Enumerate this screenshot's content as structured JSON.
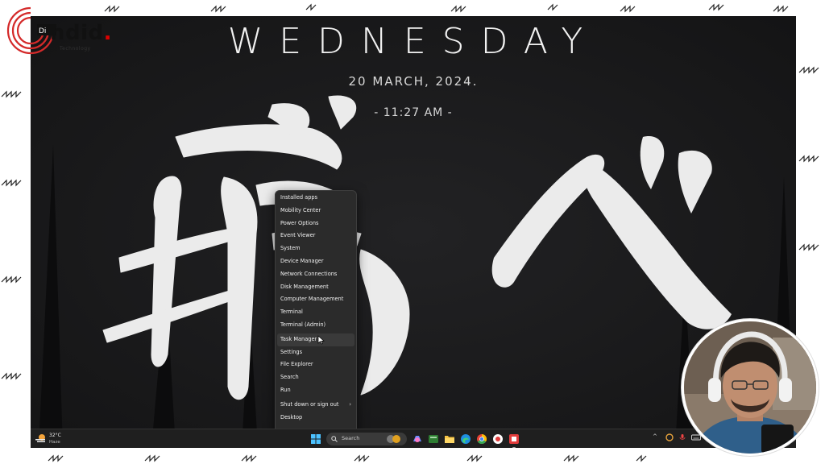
{
  "overlay": {
    "logo_text": "ndid",
    "logo_prefix": "Di",
    "logo_sub": "Technology"
  },
  "desktop": {
    "day": "WEDNESDAY",
    "date": "20  MARCH,  2024.",
    "time": "- 11:27 AM -"
  },
  "context_menu": {
    "items": [
      {
        "label": "Installed apps"
      },
      {
        "label": "Mobility Center"
      },
      {
        "label": "Power Options"
      },
      {
        "label": "Event Viewer"
      },
      {
        "label": "System"
      },
      {
        "label": "Device Manager"
      },
      {
        "label": "Network Connections"
      },
      {
        "label": "Disk Management"
      },
      {
        "label": "Computer Management"
      },
      {
        "label": "Terminal"
      },
      {
        "label": "Terminal (Admin)"
      },
      {
        "label": "Task Manager"
      },
      {
        "label": "Settings"
      },
      {
        "label": "File Explorer"
      },
      {
        "label": "Search"
      },
      {
        "label": "Run"
      },
      {
        "label": "Shut down or sign out"
      },
      {
        "label": "Desktop"
      }
    ],
    "hovered": "Task Manager"
  },
  "taskbar": {
    "weather_temp": "32°C",
    "weather_condition": "Haze",
    "search_label": "Search",
    "tray_chevron": "^"
  },
  "colors": {
    "desktop_bg": "#1d1d1f",
    "menu_bg": "#2b2b2b",
    "taskbar_bg": "#1f1f1f",
    "brush": "#ebebeb"
  }
}
